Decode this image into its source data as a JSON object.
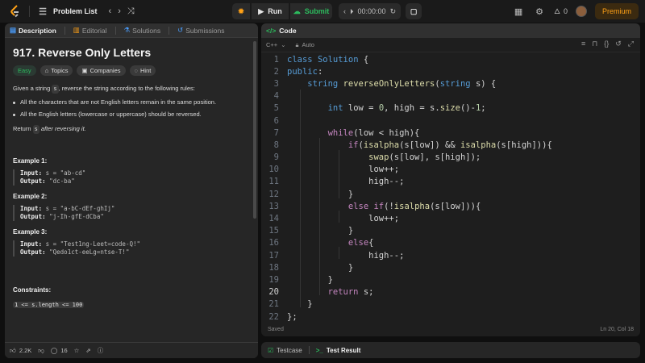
{
  "topbar": {
    "problem_list_label": "Problem List",
    "run_label": "Run",
    "submit_label": "Submit",
    "timer": "00:00:00",
    "streak_count": "0",
    "premium_label": "Premium"
  },
  "left": {
    "tabs": [
      {
        "label": "Description"
      },
      {
        "label": "Editorial"
      },
      {
        "label": "Solutions"
      },
      {
        "label": "Submissions"
      }
    ],
    "title": "917. Reverse Only Letters",
    "chips": {
      "difficulty": "Easy",
      "topics": "Topics",
      "companies": "Companies",
      "hint": "Hint"
    },
    "desc_prefix": "Given a string ",
    "desc_var": "s",
    "desc_suffix": ", reverse the string according to the following rules:",
    "rules": [
      "All the characters that are not English letters remain in the same position.",
      "All the English letters (lowercase or uppercase) should be reversed."
    ],
    "return_prefix": "Return ",
    "return_var": "s",
    "return_suffix": " after reversing it.",
    "examples": [
      {
        "title": "Example 1:",
        "input_label": "Input:",
        "input": " s = \"ab-cd\"",
        "output_label": "Output:",
        "output": " \"dc-ba\""
      },
      {
        "title": "Example 2:",
        "input_label": "Input:",
        "input": " s = \"a-bC-dEf-ghIj\"",
        "output_label": "Output:",
        "output": " \"j-Ih-gfE-dCba\""
      },
      {
        "title": "Example 3:",
        "input_label": "Input:",
        "input": " s = \"Test1ng-Leet=code-Q!\"",
        "output_label": "Output:",
        "output": " \"Qedo1ct-eeLg=ntse-T!\""
      }
    ],
    "constraints_title": "Constraints:",
    "constraint_partial": "1 <= s.length <= 100",
    "footer": {
      "likes": "2.2K",
      "comments": "16"
    }
  },
  "right": {
    "tab_label": "Code",
    "language": "C++",
    "autosave": "Auto",
    "status_left": "Saved",
    "status_right": "Ln 20, Col 18",
    "current_line": 20
  },
  "bottom": {
    "tabs": [
      {
        "label": "Testcase"
      },
      {
        "label": "Test Result"
      }
    ]
  },
  "colors": {
    "accent_green": "#2cbb5d",
    "premium_orange": "#ffa116",
    "keyword_blue": "#569cd6",
    "keyword_purple": "#c586c0",
    "function_yellow": "#dcdcaa",
    "number_green": "#b5cea8"
  }
}
